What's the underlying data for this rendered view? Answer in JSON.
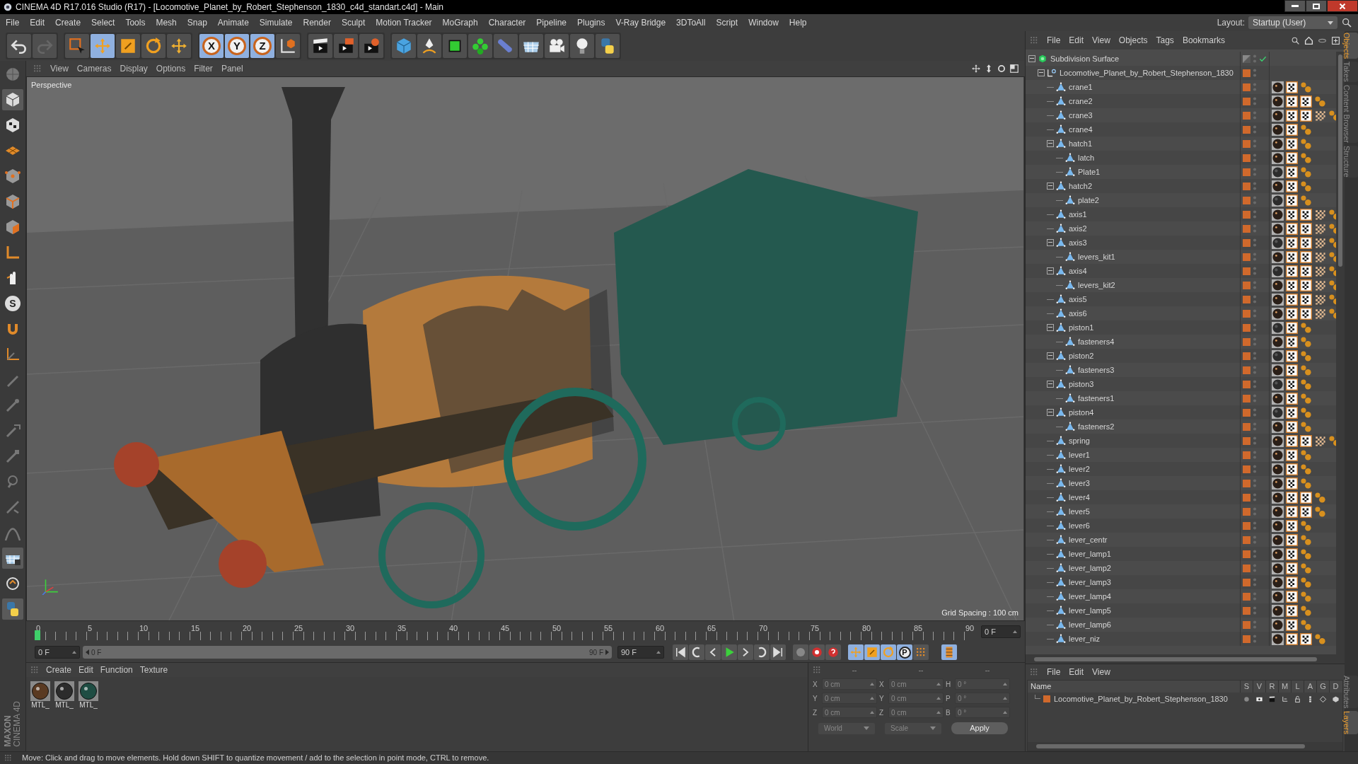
{
  "window": {
    "title": "CINEMA 4D R17.016 Studio (R17) - [Locomotive_Planet_by_Robert_Stephenson_1830_c4d_standart.c4d] - Main"
  },
  "menu_bar": [
    "File",
    "Edit",
    "Create",
    "Select",
    "Tools",
    "Mesh",
    "Snap",
    "Animate",
    "Simulate",
    "Render",
    "Sculpt",
    "Motion Tracker",
    "MoGraph",
    "Character",
    "Pipeline",
    "Plugins",
    "V-Ray Bridge",
    "3DToAll",
    "Script",
    "Window",
    "Help"
  ],
  "layout": {
    "label": "Layout:",
    "value": "Startup (User)"
  },
  "toolbar": {
    "modes": [
      {
        "kind": "select",
        "selected": false
      },
      {
        "kind": "move",
        "selected": true
      },
      {
        "kind": "scale",
        "selected": false
      },
      {
        "kind": "rotate",
        "selected": false
      },
      {
        "kind": "add",
        "selected": false
      }
    ],
    "axes": [
      {
        "label": "X",
        "on": true
      },
      {
        "label": "Y",
        "on": true
      },
      {
        "label": "Z",
        "on": true
      }
    ]
  },
  "left_toolbar": {
    "snap_label": "S"
  },
  "viewport": {
    "menu": [
      "View",
      "Cameras",
      "Display",
      "Options",
      "Filter",
      "Panel"
    ],
    "camera": "Perspective",
    "grid_spacing": "Grid Spacing : 100 cm",
    "kind": "picture"
  },
  "timeline": {
    "ruler": [
      "0",
      "5",
      "10",
      "15",
      "20",
      "25",
      "30",
      "35",
      "40",
      "45",
      "50",
      "55",
      "60",
      "65",
      "70",
      "75",
      "80",
      "85",
      "90"
    ],
    "playhead": {
      "level": 0
    },
    "current_frame": "0 F",
    "start_field": "0 F",
    "range_start": "0 F",
    "range_end": "90 F",
    "range": {
      "level": 1
    },
    "end_field": "90 F",
    "key_label": "P"
  },
  "material_manager": {
    "menu": [
      "Create",
      "Edit",
      "Function",
      "Texture"
    ],
    "materials": [
      {
        "label": "MTL_",
        "color": "#5a3a22"
      },
      {
        "label": "MTL_",
        "color": "#2c2c2c"
      },
      {
        "label": "MTL_",
        "color": "#1f4d43"
      }
    ]
  },
  "coordinates": {
    "headers": [
      "--",
      "--",
      "--"
    ],
    "rows": [
      {
        "axis": "X",
        "position": "0 cm",
        "size_axis": "X",
        "size": "0 cm",
        "rot_axis": "H",
        "rotation": "0 °"
      },
      {
        "axis": "Y",
        "position": "0 cm",
        "size_axis": "Y",
        "size": "0 cm",
        "rot_axis": "P",
        "rotation": "0 °"
      },
      {
        "axis": "Z",
        "position": "0 cm",
        "size_axis": "Z",
        "size": "0 cm",
        "rot_axis": "B",
        "rotation": "0 °"
      }
    ],
    "space": "World",
    "mode": "Scale",
    "apply": "Apply"
  },
  "object_manager": {
    "menu": [
      "File",
      "Edit",
      "View",
      "Objects",
      "Tags",
      "Bookmarks"
    ],
    "tree": [
      {
        "name": "Subdivision Surface",
        "kind": "generator",
        "expanded": true,
        "on_layer": false,
        "enabled": true,
        "children": [
          {
            "name": "Locomotive_Planet_by_Robert_Stephenson_1830",
            "kind": "null",
            "expanded": true,
            "on_layer": true,
            "children": [
              {
                "name": "crane1",
                "kind": "polygon",
                "on_layer": true,
                "tags": [
                  {
                    "kind": "glossy"
                  },
                  {
                    "kind": "uvw"
                  },
                  {
                    "kind": "phong"
                  }
                ]
              },
              {
                "name": "crane2",
                "kind": "polygon",
                "on_layer": true,
                "tags": [
                  {
                    "kind": "glossy"
                  },
                  {
                    "kind": "uvw"
                  },
                  {
                    "kind": "uvw"
                  },
                  {
                    "kind": "phong"
                  }
                ]
              },
              {
                "name": "crane3",
                "kind": "polygon",
                "on_layer": true,
                "tags": [
                  {
                    "kind": "glossy"
                  },
                  {
                    "kind": "uvw"
                  },
                  {
                    "kind": "uvw"
                  },
                  {
                    "kind": "pattern"
                  },
                  {
                    "kind": "phong"
                  }
                ]
              },
              {
                "name": "crane4",
                "kind": "polygon",
                "on_layer": true,
                "tags": [
                  {
                    "kind": "glossy"
                  },
                  {
                    "kind": "uvw"
                  },
                  {
                    "kind": "phong"
                  }
                ]
              },
              {
                "name": "hatch1",
                "kind": "polygon",
                "expanded": true,
                "on_layer": true,
                "tags": [
                  {
                    "kind": "glossy"
                  },
                  {
                    "kind": "uvw"
                  },
                  {
                    "kind": "phong"
                  }
                ],
                "children": [
                  {
                    "name": "latch",
                    "kind": "polygon",
                    "on_layer": true,
                    "tags": [
                      {
                        "kind": "glossy"
                      },
                      {
                        "kind": "uvw"
                      },
                      {
                        "kind": "phong"
                      }
                    ]
                  },
                  {
                    "name": "Plate1",
                    "kind": "polygon",
                    "on_layer": true,
                    "tags": [
                      {
                        "kind": "matte"
                      },
                      {
                        "kind": "uvw"
                      },
                      {
                        "kind": "phong"
                      }
                    ]
                  }
                ]
              },
              {
                "name": "hatch2",
                "kind": "polygon",
                "expanded": true,
                "on_layer": true,
                "tags": [
                  {
                    "kind": "glossy"
                  },
                  {
                    "kind": "uvw"
                  },
                  {
                    "kind": "phong"
                  }
                ],
                "children": [
                  {
                    "name": "plate2",
                    "kind": "polygon",
                    "on_layer": true,
                    "tags": [
                      {
                        "kind": "matte"
                      },
                      {
                        "kind": "uvw"
                      },
                      {
                        "kind": "phong"
                      }
                    ]
                  }
                ]
              },
              {
                "name": "axis1",
                "kind": "polygon",
                "on_layer": true,
                "tags": [
                  {
                    "kind": "glossy"
                  },
                  {
                    "kind": "uvw"
                  },
                  {
                    "kind": "uvw"
                  },
                  {
                    "kind": "pattern"
                  },
                  {
                    "kind": "phong"
                  }
                ]
              },
              {
                "name": "axis2",
                "kind": "polygon",
                "on_layer": true,
                "tags": [
                  {
                    "kind": "glossy"
                  },
                  {
                    "kind": "uvw"
                  },
                  {
                    "kind": "uvw"
                  },
                  {
                    "kind": "pattern"
                  },
                  {
                    "kind": "phong"
                  }
                ]
              },
              {
                "name": "axis3",
                "kind": "polygon",
                "expanded": true,
                "on_layer": true,
                "tags": [
                  {
                    "kind": "matte"
                  },
                  {
                    "kind": "uvw"
                  },
                  {
                    "kind": "uvw"
                  },
                  {
                    "kind": "pattern"
                  },
                  {
                    "kind": "phong"
                  }
                ],
                "children": [
                  {
                    "name": "levers_kit1",
                    "kind": "polygon",
                    "on_layer": true,
                    "tags": [
                      {
                        "kind": "glossy"
                      },
                      {
                        "kind": "uvw"
                      },
                      {
                        "kind": "uvw"
                      },
                      {
                        "kind": "pattern"
                      },
                      {
                        "kind": "phong"
                      }
                    ]
                  }
                ]
              },
              {
                "name": "axis4",
                "kind": "polygon",
                "expanded": true,
                "on_layer": true,
                "tags": [
                  {
                    "kind": "matte"
                  },
                  {
                    "kind": "uvw"
                  },
                  {
                    "kind": "uvw"
                  },
                  {
                    "kind": "pattern"
                  },
                  {
                    "kind": "phong"
                  }
                ],
                "children": [
                  {
                    "name": "levers_kit2",
                    "kind": "polygon",
                    "on_layer": true,
                    "tags": [
                      {
                        "kind": "glossy"
                      },
                      {
                        "kind": "uvw"
                      },
                      {
                        "kind": "uvw"
                      },
                      {
                        "kind": "pattern"
                      },
                      {
                        "kind": "phong"
                      }
                    ]
                  }
                ]
              },
              {
                "name": "axis5",
                "kind": "polygon",
                "on_layer": true,
                "tags": [
                  {
                    "kind": "glossy"
                  },
                  {
                    "kind": "uvw"
                  },
                  {
                    "kind": "uvw"
                  },
                  {
                    "kind": "pattern"
                  },
                  {
                    "kind": "phong"
                  }
                ]
              },
              {
                "name": "axis6",
                "kind": "polygon",
                "on_layer": true,
                "tags": [
                  {
                    "kind": "glossy"
                  },
                  {
                    "kind": "uvw"
                  },
                  {
                    "kind": "uvw"
                  },
                  {
                    "kind": "pattern"
                  },
                  {
                    "kind": "phong"
                  }
                ]
              },
              {
                "name": "piston1",
                "kind": "polygon",
                "expanded": true,
                "on_layer": true,
                "tags": [
                  {
                    "kind": "matte"
                  },
                  {
                    "kind": "uvw"
                  },
                  {
                    "kind": "phong"
                  }
                ],
                "children": [
                  {
                    "name": "fasteners4",
                    "kind": "polygon",
                    "on_layer": true,
                    "tags": [
                      {
                        "kind": "glossy"
                      },
                      {
                        "kind": "uvw"
                      },
                      {
                        "kind": "phong"
                      }
                    ]
                  }
                ]
              },
              {
                "name": "piston2",
                "kind": "polygon",
                "expanded": true,
                "on_layer": true,
                "tags": [
                  {
                    "kind": "matte"
                  },
                  {
                    "kind": "uvw"
                  },
                  {
                    "kind": "phong"
                  }
                ],
                "children": [
                  {
                    "name": "fasteners3",
                    "kind": "polygon",
                    "on_layer": true,
                    "tags": [
                      {
                        "kind": "glossy"
                      },
                      {
                        "kind": "uvw"
                      },
                      {
                        "kind": "phong"
                      }
                    ]
                  }
                ]
              },
              {
                "name": "piston3",
                "kind": "polygon",
                "expanded": true,
                "on_layer": true,
                "tags": [
                  {
                    "kind": "matte"
                  },
                  {
                    "kind": "uvw"
                  },
                  {
                    "kind": "phong"
                  }
                ],
                "children": [
                  {
                    "name": "fasteners1",
                    "kind": "polygon",
                    "on_layer": true,
                    "tags": [
                      {
                        "kind": "glossy"
                      },
                      {
                        "kind": "uvw"
                      },
                      {
                        "kind": "phong"
                      }
                    ]
                  }
                ]
              },
              {
                "name": "piston4",
                "kind": "polygon",
                "expanded": true,
                "on_layer": true,
                "tags": [
                  {
                    "kind": "matte"
                  },
                  {
                    "kind": "uvw"
                  },
                  {
                    "kind": "phong"
                  }
                ],
                "children": [
                  {
                    "name": "fasteners2",
                    "kind": "polygon",
                    "on_layer": true,
                    "tags": [
                      {
                        "kind": "glossy"
                      },
                      {
                        "kind": "uvw"
                      },
                      {
                        "kind": "phong"
                      }
                    ]
                  }
                ]
              },
              {
                "name": "spring",
                "kind": "polygon",
                "on_layer": true,
                "tags": [
                  {
                    "kind": "glossy"
                  },
                  {
                    "kind": "uvw"
                  },
                  {
                    "kind": "uvw"
                  },
                  {
                    "kind": "pattern"
                  },
                  {
                    "kind": "phong"
                  }
                ]
              },
              {
                "name": "lever1",
                "kind": "polygon",
                "on_layer": true,
                "tags": [
                  {
                    "kind": "glossy"
                  },
                  {
                    "kind": "uvw"
                  },
                  {
                    "kind": "phong"
                  }
                ]
              },
              {
                "name": "lever2",
                "kind": "polygon",
                "on_layer": true,
                "tags": [
                  {
                    "kind": "glossy"
                  },
                  {
                    "kind": "uvw"
                  },
                  {
                    "kind": "phong"
                  }
                ]
              },
              {
                "name": "lever3",
                "kind": "polygon",
                "on_layer": true,
                "tags": [
                  {
                    "kind": "glossy"
                  },
                  {
                    "kind": "uvw"
                  },
                  {
                    "kind": "phong"
                  }
                ]
              },
              {
                "name": "lever4",
                "kind": "polygon",
                "on_layer": true,
                "tags": [
                  {
                    "kind": "glossy"
                  },
                  {
                    "kind": "uvw"
                  },
                  {
                    "kind": "uvw"
                  },
                  {
                    "kind": "phong"
                  }
                ]
              },
              {
                "name": "lever5",
                "kind": "polygon",
                "on_layer": true,
                "tags": [
                  {
                    "kind": "glossy"
                  },
                  {
                    "kind": "uvw"
                  },
                  {
                    "kind": "uvw"
                  },
                  {
                    "kind": "phong"
                  }
                ]
              },
              {
                "name": "lever6",
                "kind": "polygon",
                "on_layer": true,
                "tags": [
                  {
                    "kind": "glossy"
                  },
                  {
                    "kind": "uvw"
                  },
                  {
                    "kind": "phong"
                  }
                ]
              },
              {
                "name": "lever_centr",
                "kind": "polygon",
                "on_layer": true,
                "tags": [
                  {
                    "kind": "glossy"
                  },
                  {
                    "kind": "uvw"
                  },
                  {
                    "kind": "phong"
                  }
                ]
              },
              {
                "name": "lever_lamp1",
                "kind": "polygon",
                "on_layer": true,
                "tags": [
                  {
                    "kind": "glossy"
                  },
                  {
                    "kind": "uvw"
                  },
                  {
                    "kind": "phong"
                  }
                ]
              },
              {
                "name": "lever_lamp2",
                "kind": "polygon",
                "on_layer": true,
                "tags": [
                  {
                    "kind": "glossy"
                  },
                  {
                    "kind": "uvw"
                  },
                  {
                    "kind": "phong"
                  }
                ]
              },
              {
                "name": "lever_lamp3",
                "kind": "polygon",
                "on_layer": true,
                "tags": [
                  {
                    "kind": "glossy"
                  },
                  {
                    "kind": "uvw"
                  },
                  {
                    "kind": "phong"
                  }
                ]
              },
              {
                "name": "lever_lamp4",
                "kind": "polygon",
                "on_layer": true,
                "tags": [
                  {
                    "kind": "glossy"
                  },
                  {
                    "kind": "uvw"
                  },
                  {
                    "kind": "phong"
                  }
                ]
              },
              {
                "name": "lever_lamp5",
                "kind": "polygon",
                "on_layer": true,
                "tags": [
                  {
                    "kind": "glossy"
                  },
                  {
                    "kind": "uvw"
                  },
                  {
                    "kind": "phong"
                  }
                ]
              },
              {
                "name": "lever_lamp6",
                "kind": "polygon",
                "on_layer": true,
                "tags": [
                  {
                    "kind": "glossy"
                  },
                  {
                    "kind": "uvw"
                  },
                  {
                    "kind": "phong"
                  }
                ]
              },
              {
                "name": "lever_niz",
                "kind": "polygon",
                "on_layer": true,
                "tags": [
                  {
                    "kind": "glossy"
                  },
                  {
                    "kind": "uvw"
                  },
                  {
                    "kind": "uvw"
                  },
                  {
                    "kind": "phong"
                  }
                ]
              }
            ]
          }
        ]
      }
    ]
  },
  "layer_manager": {
    "menu": [
      "File",
      "Edit",
      "View"
    ],
    "columns": [
      "Name",
      "S",
      "V",
      "R",
      "M",
      "L",
      "A",
      "G",
      "D"
    ],
    "layers": [
      {
        "name": "Locomotive_Planet_by_Robert_Stephenson_1830",
        "color": "#d0692c"
      }
    ]
  },
  "side_tabs_top": [
    {
      "label": "Objects",
      "selected": true
    },
    {
      "label": "Takes",
      "selected": false
    },
    {
      "label": "Content Browser",
      "selected": false
    },
    {
      "label": "Structure",
      "selected": false
    }
  ],
  "side_tabs_bottom": [
    {
      "label": "Attributes",
      "selected": false
    },
    {
      "label": "Layers",
      "selected": true
    }
  ],
  "logo": {
    "brand": "MAXON",
    "product": "CINEMA 4D"
  },
  "status_bar": "Move: Click and drag to move elements. Hold down SHIFT to quantize movement / add to the selection in point mode, CTRL to remove."
}
